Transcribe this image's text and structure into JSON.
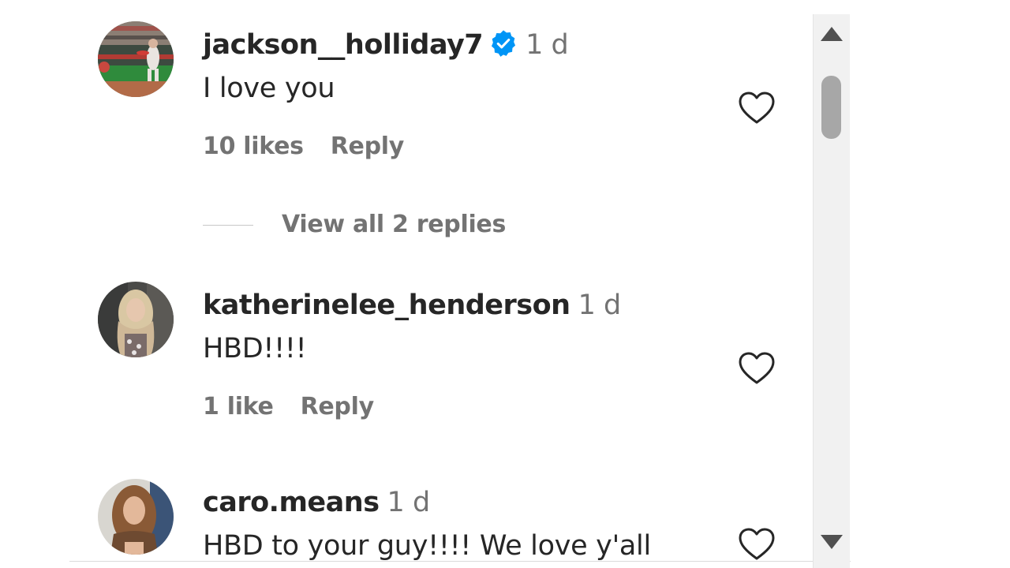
{
  "icons": {
    "verified": "verified-badge-icon",
    "like": "heart-outline-icon",
    "scroll_up": "triangle-up-icon",
    "scroll_down": "triangle-down-icon"
  },
  "colors": {
    "username": "#262626",
    "secondary_text": "#737373",
    "verified_blue": "#0095f6",
    "scroll_track": "#f1f1f1",
    "scroll_thumb": "#a7a7a7"
  },
  "comments": [
    {
      "username": "jackson__holliday7",
      "verified": true,
      "time": "1 d",
      "text": "I love you",
      "likes": "10 likes",
      "reply_label": "Reply",
      "view_replies": "View all 2 replies"
    },
    {
      "username": "katherinelee_henderson",
      "verified": false,
      "time": "1 d",
      "text": "HBD!!!!",
      "likes": "1 like",
      "reply_label": "Reply"
    },
    {
      "username": "caro.means",
      "verified": false,
      "time": "1 d",
      "text": "HBD to your guy!!!! We love y'all"
    }
  ]
}
